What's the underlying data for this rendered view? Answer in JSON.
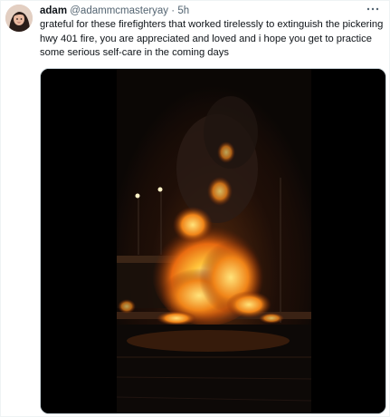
{
  "tweet": {
    "display_name": "adam",
    "handle": "@adammcmasteryay",
    "separator": "·",
    "time": "5h",
    "text": "grateful for these firefighters that worked tirelessly to extinguish the pickering hwy 401 fire, you are appreciated and loved and i hope you get to practice some serious self-care in the coming days",
    "more_icon": "more-horizontal-icon",
    "media_type": "video"
  },
  "colors": {
    "text_primary": "#0f1419",
    "text_secondary": "#536471",
    "media_background": "#000000",
    "fire": "#ff9a1a"
  }
}
